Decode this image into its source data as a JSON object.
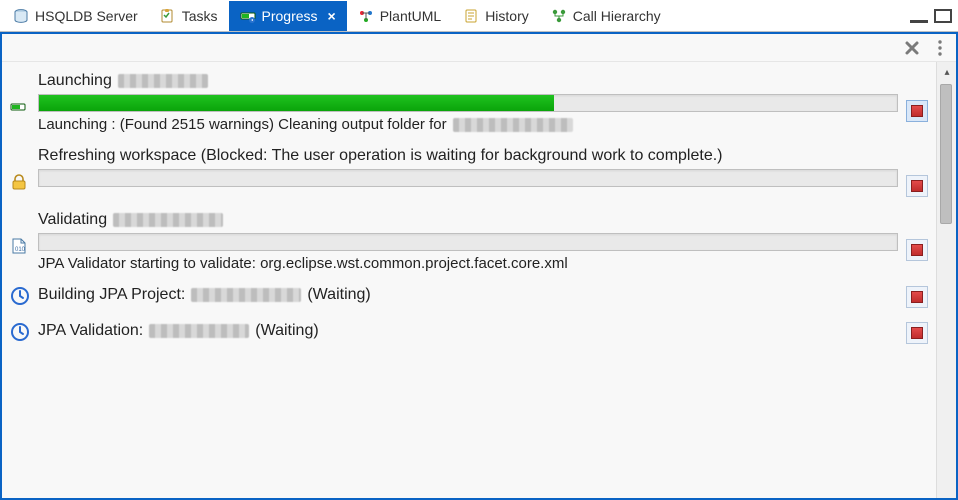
{
  "tabs": [
    {
      "label": "HSQLDB Server",
      "active": false
    },
    {
      "label": "Tasks",
      "active": false
    },
    {
      "label": "Progress",
      "active": true
    },
    {
      "label": "PlantUML",
      "active": false
    },
    {
      "label": "History",
      "active": false
    },
    {
      "label": "Call Hierarchy",
      "active": false
    }
  ],
  "items": [
    {
      "type": "progress",
      "icon": "run-icon",
      "title_prefix": "Launching ",
      "title_blur_width": 90,
      "progress_pct": 60,
      "detail_prefix": "Launching : (Found 2515 warnings) Cleaning output folder for ",
      "detail_blur_width": 120
    },
    {
      "type": "progress",
      "icon": "lock-icon",
      "title_prefix": "Refreshing workspace (Blocked: The user operation is waiting for background work to complete.)",
      "title_blur_width": 0,
      "progress_pct": 0,
      "detail_prefix": "",
      "detail_blur_width": 0
    },
    {
      "type": "progress",
      "icon": "file-icon",
      "title_prefix": "Validating ",
      "title_blur_width": 110,
      "progress_pct": 0,
      "detail_prefix": "JPA Validator starting to validate: org.eclipse.wst.common.project.facet.core.xml",
      "detail_blur_width": 0
    },
    {
      "type": "waiting",
      "icon": "clock-icon",
      "title_prefix": "Building JPA Project: ",
      "title_blur_width": 110,
      "title_suffix": " (Waiting)"
    },
    {
      "type": "waiting",
      "icon": "clock-icon",
      "title_prefix": "JPA Validation: ",
      "title_blur_width": 100,
      "title_suffix": " (Waiting)"
    }
  ],
  "icons": {
    "remove_all_label": "Remove All Finished Operations",
    "menu_label": "View Menu"
  }
}
